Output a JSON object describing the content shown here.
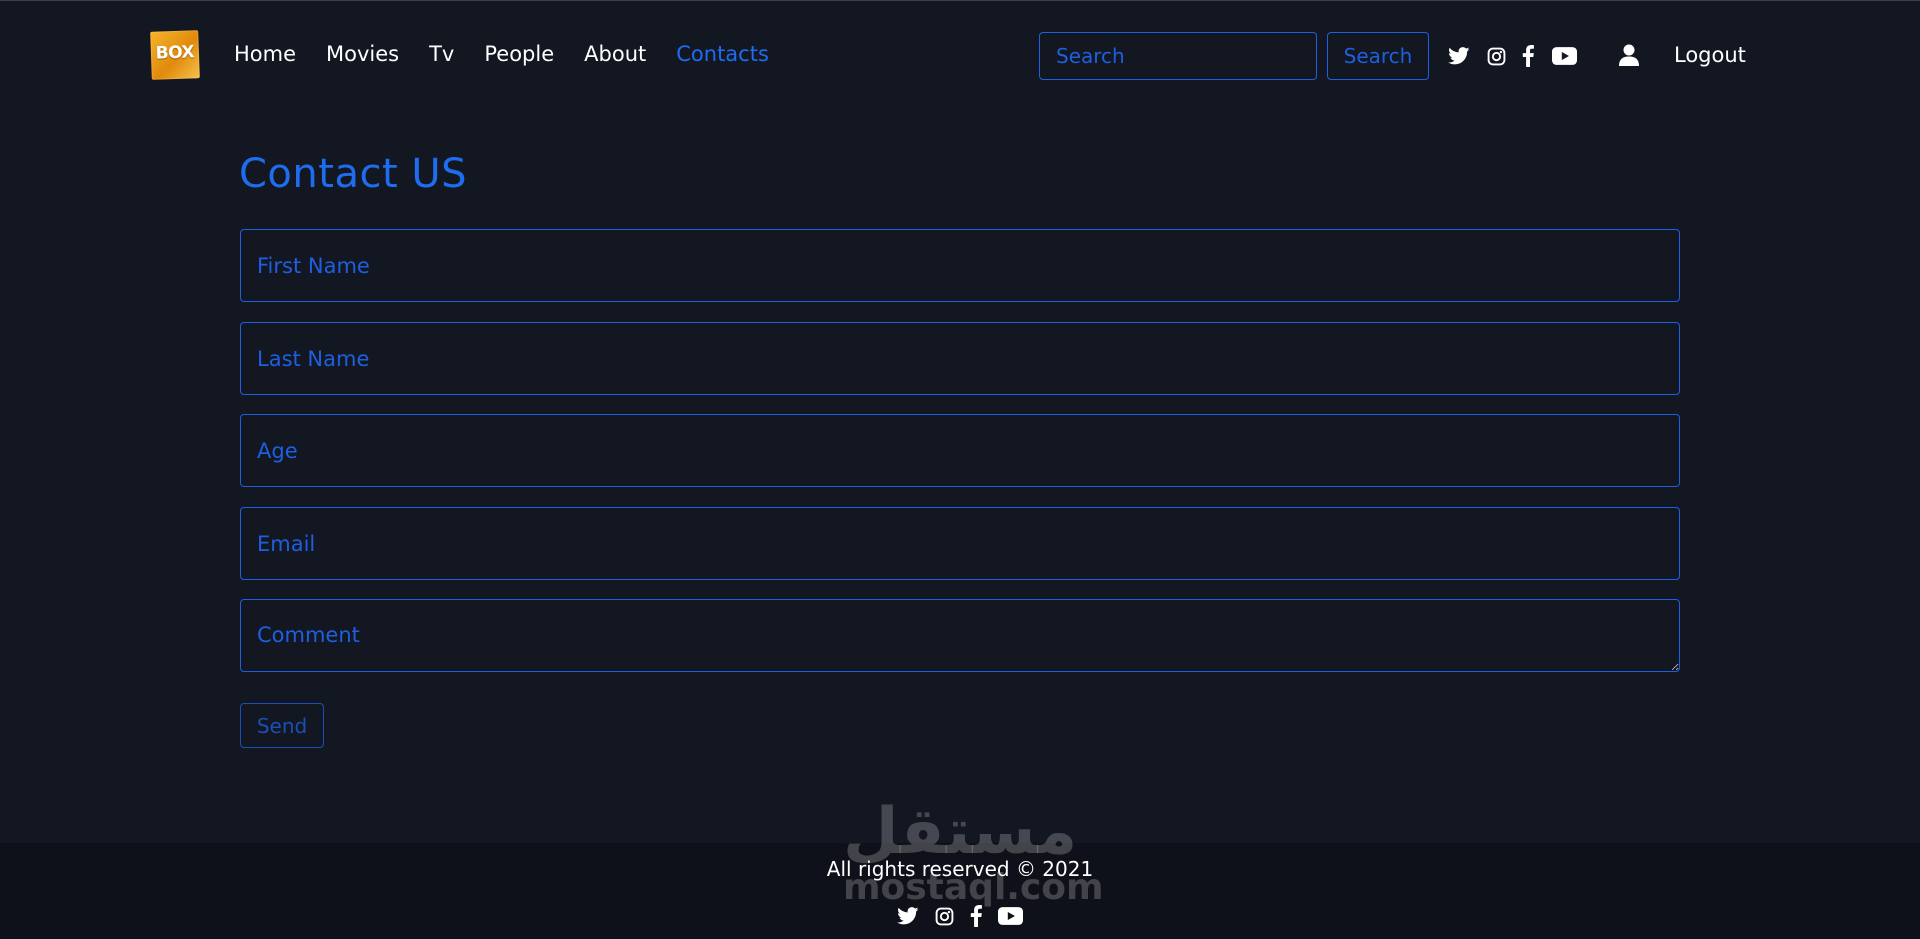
{
  "brand": {
    "logo_text": "BOX"
  },
  "nav": {
    "links": [
      {
        "label": "Home"
      },
      {
        "label": "Movies"
      },
      {
        "label": "Tv"
      },
      {
        "label": "People"
      },
      {
        "label": "About"
      },
      {
        "label": "Contacts",
        "active": true
      }
    ],
    "search_placeholder": "Search",
    "search_button": "Search",
    "social_icons": [
      "twitter-icon",
      "instagram-icon",
      "facebook-icon",
      "youtube-icon"
    ],
    "user_icon": "user-icon",
    "logout_label": "Logout"
  },
  "main": {
    "title": "Contact US",
    "fields": {
      "first_name_placeholder": "First Name",
      "last_name_placeholder": "Last Name",
      "age_placeholder": "Age",
      "email_placeholder": "Email",
      "comment_placeholder": "Comment"
    },
    "send_label": "Send"
  },
  "footer": {
    "copyright": "All rights reserved © 2021",
    "social_icons": [
      "twitter-icon",
      "instagram-icon",
      "facebook-icon",
      "youtube-icon"
    ]
  },
  "watermark": {
    "arabic": "مستقل",
    "latin": "mostaql.com"
  },
  "colors": {
    "background": "#131722",
    "footer_background": "#0e1119",
    "accent": "#1e6cf0",
    "logo": "#f0a11b"
  }
}
